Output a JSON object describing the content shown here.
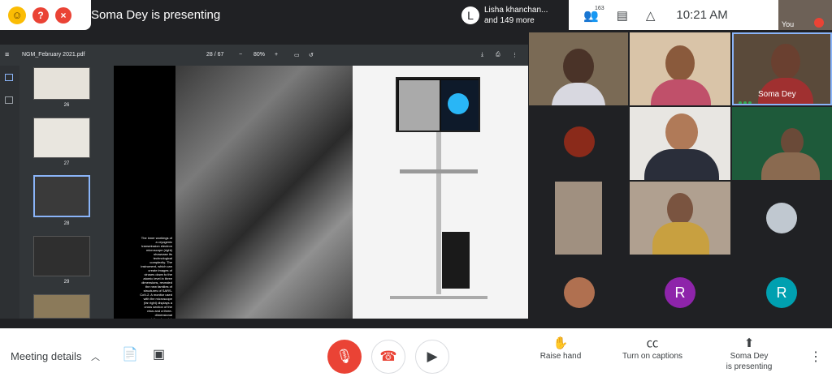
{
  "top": {
    "presenter_title": "Soma Dey is presenting",
    "chat_toast": {
      "initial": "L",
      "line1": "Lisha khanchan...",
      "line2": "and 149 more"
    },
    "participant_count": "163",
    "clock": "10:21 AM",
    "self_label": "You"
  },
  "pdf": {
    "filename": "NGM_February 2021.pdf",
    "page_display": "28 / 67",
    "zoom": "80%",
    "thumbnails": [
      {
        "label": "26"
      },
      {
        "label": "27"
      },
      {
        "label": "28",
        "selected": true
      },
      {
        "label": "29"
      }
    ],
    "caption_text": "The inner workings of a cryogenic transmission electron microscope (right) showcase its technological complexity. The instrument, which can create images of viruses down to the atomic level in three dimensions, revealed the new families of structures of SARS-CoV-2. A monitor used with the microscope (far right) displays a cross section of the virus and a three-dimensional computational model."
  },
  "participants": {
    "tiles": [
      {
        "name": ""
      },
      {
        "name": ""
      },
      {
        "name": "Soma Dey"
      },
      {
        "name": ""
      },
      {
        "name": ""
      },
      {
        "name": ""
      },
      {
        "name": ""
      },
      {
        "name": ""
      },
      {
        "name": ""
      },
      {
        "name": ""
      },
      {
        "name": "",
        "initial": "R"
      },
      {
        "name": "",
        "initial": "R"
      }
    ]
  },
  "bottom": {
    "meeting_details": "Meeting details",
    "raise_hand": "Raise hand",
    "captions": "Turn on captions",
    "presenting_line1": "Soma Dey",
    "presenting_line2": "is presenting"
  },
  "colors": {
    "accent_red": "#ea4335",
    "purple_avatar": "#8e24aa",
    "teal_avatar": "#00a0b0",
    "dark": "#202124",
    "light_icon": "#8ab4f8"
  }
}
